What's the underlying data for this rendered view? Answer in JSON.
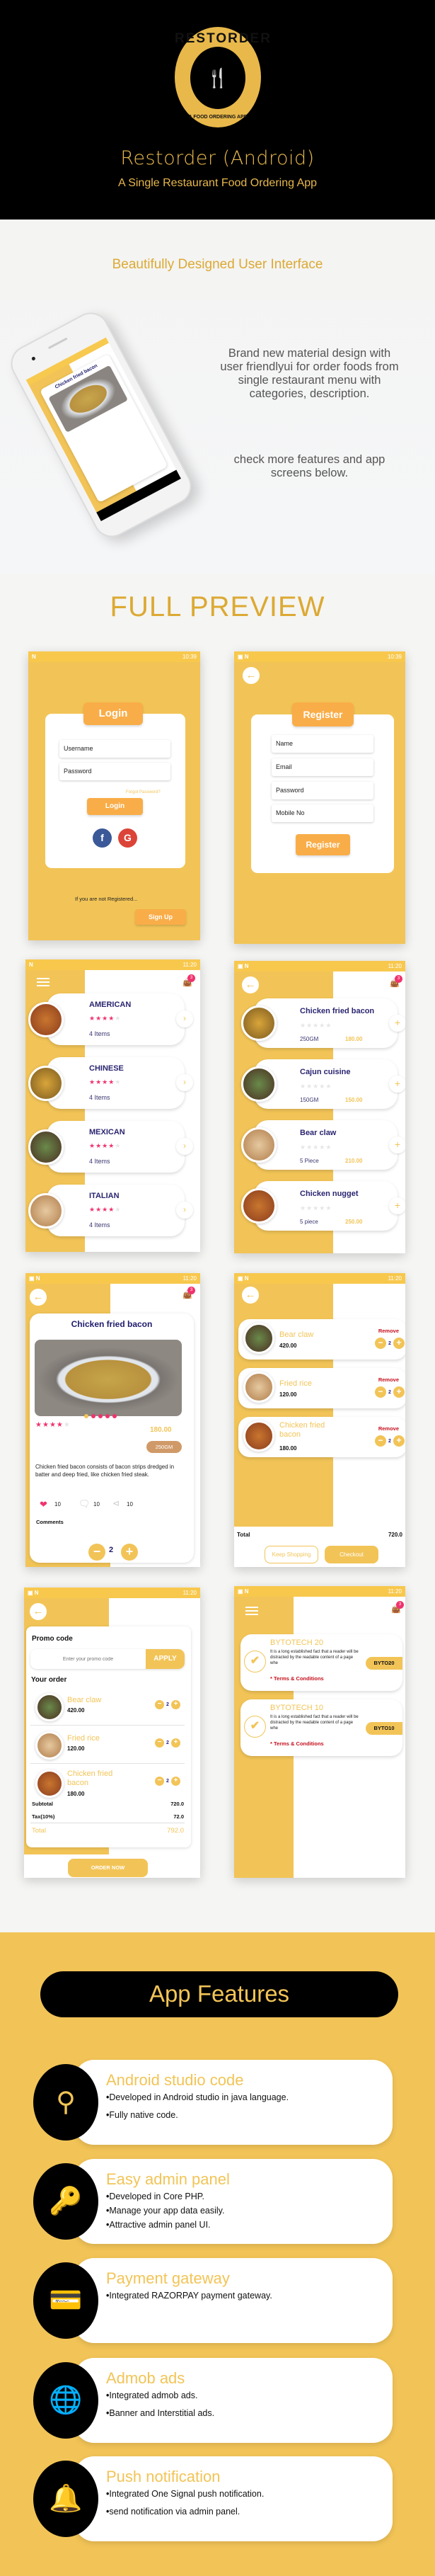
{
  "header": {
    "logo": {
      "ring_top": "RESTORDER",
      "ring_bottom": "A FOOD ORDERING APP",
      "icon": "cutlery-icon"
    },
    "title": "Restorder (Android)",
    "subtitle": "A Single Restaurant Food Ordering App"
  },
  "intro": {
    "heading": "Beautifully  Designed  User Interface",
    "paragraph1": "Brand new material design with user friendlyui for order foods from single restaurant menu with categories, description.",
    "paragraph2": "check more features and app screens below.",
    "phone_screen_title": "Chicken fried bacon"
  },
  "full_preview": {
    "heading": "FULL PREVIEW"
  },
  "screens": {
    "login": {
      "time": "10:39",
      "title": "Login",
      "username_placeholder": "Username",
      "password_placeholder": "Password",
      "forgot": "Forgot Password?",
      "login_button": "Login",
      "facebook": "f",
      "google": "G",
      "not_registered": "If you are not Registered...",
      "signup_button": "Sign Up"
    },
    "register": {
      "time": "10:39",
      "title": "Register",
      "fields": [
        "Name",
        "Email",
        "Password",
        "Mobile No"
      ],
      "register_button": "Register"
    },
    "categories": {
      "time": "11:20",
      "cart_count": "3",
      "items": [
        {
          "name": "AMERICAN",
          "rating": 4,
          "count": "4 Items"
        },
        {
          "name": "CHINESE",
          "rating": 4,
          "count": "4 Items"
        },
        {
          "name": "MEXICAN",
          "rating": 4,
          "count": "4 Items"
        },
        {
          "name": "ITALIAN",
          "rating": 4,
          "count": "4 Items"
        }
      ]
    },
    "items": {
      "time": "11:20",
      "cart_count": "3",
      "items": [
        {
          "name": "Chicken fried bacon",
          "rating": 0,
          "qty": "250GM",
          "price": "180.00"
        },
        {
          "name": "Cajun cuisine",
          "rating": 0,
          "qty": "150GM",
          "price": "150.00"
        },
        {
          "name": "Bear claw",
          "rating": 0,
          "qty": "5 Piece",
          "price": "210.00"
        },
        {
          "name": "Chicken nugget",
          "rating": 0,
          "qty": "5 piece",
          "price": "250.00"
        }
      ]
    },
    "detail": {
      "time": "11:20",
      "cart_count": "3",
      "title": "Chicken fried bacon",
      "rating": 4,
      "price": "180.00",
      "weight": "250GM",
      "description": "Chicken fried bacon consists of bacon strips dredged in batter and deep fried, like chicken fried steak.",
      "likes": "10",
      "comments_count": "10",
      "shares": "10",
      "comments_label": "Comments",
      "quantity": "2",
      "carousel_active": 1,
      "carousel_total": 5
    },
    "cart": {
      "time": "11:20",
      "items": [
        {
          "name": "Bear claw",
          "price": "420.00",
          "qty": "2",
          "remove": "Remove"
        },
        {
          "name": "Fried rice",
          "price": "120.00",
          "qty": "2",
          "remove": "Remove"
        },
        {
          "name": "Chicken fried bacon",
          "price": "180.00",
          "qty": "2",
          "remove": "Remove"
        }
      ],
      "total_label": "Total",
      "total_value": "720.0",
      "keep_shopping": "Keep Shopping",
      "checkout": "Checkout"
    },
    "checkout": {
      "time": "11:20",
      "promo_label": "Promo code",
      "promo_placeholder": "Enter your promo code",
      "apply": "APPLY",
      "your_order": "Your order",
      "items": [
        {
          "name": "Bear claw",
          "price": "420.00",
          "qty": "2"
        },
        {
          "name": "Fried rice",
          "price": "120.00",
          "qty": "2"
        },
        {
          "name": "Chicken fried bacon",
          "price": "180.00",
          "qty": "2"
        }
      ],
      "subtotal_label": "Subtotal",
      "subtotal": "720.0",
      "tax_label": "Tax(10%)",
      "tax": "72.0",
      "total_label": "Total",
      "total": "792.0",
      "order_now": "ORDER NOW"
    },
    "coupons": {
      "time": "11:20",
      "cart_count": "3",
      "items": [
        {
          "title": "BYTOTECH 20",
          "desc": "It is a long established fact that a reader will be distracted by the readable content of a page whe",
          "terms": "* Terms & Conditions",
          "code": "BYTO20"
        },
        {
          "title": "BYTOTECH 10",
          "desc": "It is a long established fact that a reader will be distracted by the readable content of a page whe",
          "terms": "* Terms & Conditions",
          "code": "BYTO10"
        }
      ]
    }
  },
  "features": {
    "heading": "App Features",
    "items": [
      {
        "icon": "android-studio-compass-icon",
        "title": "Android studio code",
        "bullets": [
          "Developed in Android studio in java language.",
          "Fully native code."
        ]
      },
      {
        "icon": "key-icon",
        "title": "Easy admin panel",
        "bullets": [
          "Developed in Core PHP.",
          "Manage your app data easily.",
          "Attractive admin panel UI."
        ]
      },
      {
        "icon": "credit-card-icon",
        "title": "Payment gateway",
        "bullets": [
          "Integrated RAZORPAY payment gateway."
        ]
      },
      {
        "icon": "mobile-globe-icon",
        "title": "Admob ads",
        "bullets": [
          "Integrated admob ads.",
          "Banner and Interstitial ads."
        ]
      },
      {
        "icon": "bell-icon",
        "title": "Push notification",
        "bullets": [
          "Integrated One Signal push notification.",
          "send notification via admin panel."
        ]
      }
    ]
  },
  "colors": {
    "brand_yellow": "#f2c457",
    "accent_orange": "#f9ad48",
    "header_bg": "#000000",
    "title_gold": "#e7b84c",
    "pink": "#f0336e",
    "navy": "#2a2570",
    "remove_red": "#c4101d"
  }
}
